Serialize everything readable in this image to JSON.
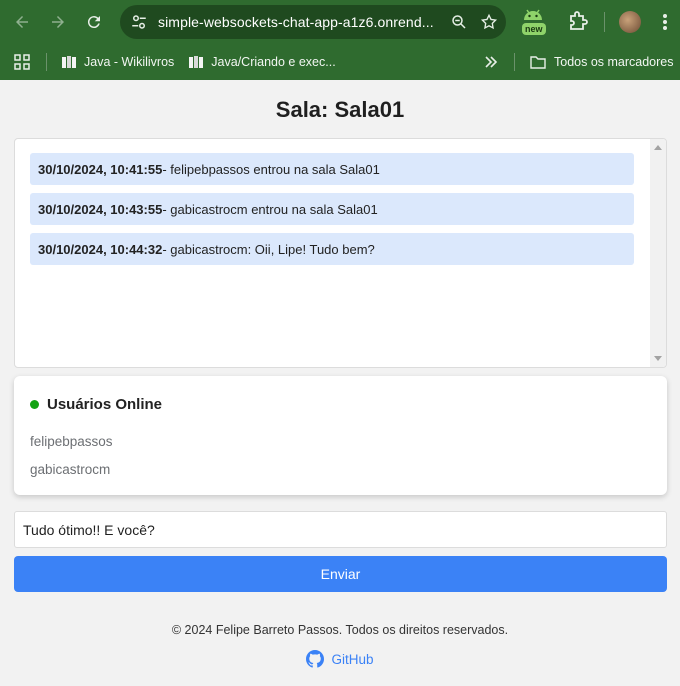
{
  "browser": {
    "url": "simple-websockets-chat-app-a1z6.onrend...",
    "extension_badge": "new",
    "bookmarks": [
      {
        "label": "Java - Wikilivros"
      },
      {
        "label": "Java/Criando e exec..."
      }
    ],
    "all_bookmarks_label": "Todos os marcadores"
  },
  "page": {
    "title": "Sala: Sala01"
  },
  "messages": [
    {
      "timestamp": "30/10/2024, 10:41:55",
      "text": " - felipebpassos entrou na sala Sala01"
    },
    {
      "timestamp": "30/10/2024, 10:43:55",
      "text": " - gabicastrocm entrou na sala Sala01"
    },
    {
      "timestamp": "30/10/2024, 10:44:32",
      "text": " - gabicastrocm: Oii, Lipe! Tudo bem?"
    }
  ],
  "users_panel": {
    "title": "Usuários Online",
    "status_color": "#13a313",
    "users": [
      "felipebpassos",
      "gabicastrocm"
    ]
  },
  "composer": {
    "input_value": "Tudo ótimo!! E você?",
    "send_label": "Enviar"
  },
  "footer": {
    "copyright": "© 2024 Felipe Barreto Passos. Todos os direitos reservados.",
    "github_label": "GitHub"
  },
  "colors": {
    "accent": "#3b82f6",
    "chrome_green": "#2f6b2f",
    "message_bg": "#dbe8fc"
  }
}
